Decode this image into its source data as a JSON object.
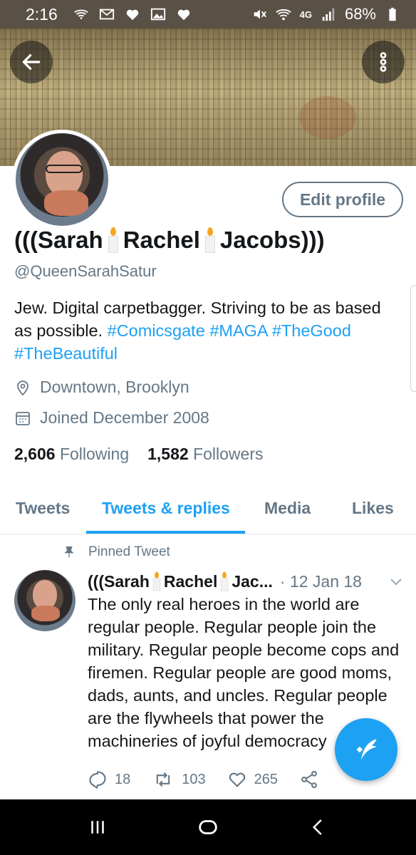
{
  "status_bar": {
    "time": "2:16",
    "battery": "68%",
    "network": "4G"
  },
  "profile": {
    "name_parts": [
      "(((Sarah",
      "Rachel",
      "Jacobs)))"
    ],
    "handle": "@QueenSarahSatur",
    "bio_text": "Jew. Digital carpetbagger. Striving to be as based as possible.",
    "bio_tags": [
      "#Comicsgate",
      "#MAGA",
      "#TheGood",
      "#TheBeautiful"
    ],
    "location": "Downtown, Brooklyn",
    "joined": "Joined December 2008",
    "following_count": "2,606",
    "following_label": "Following",
    "followers_count": "1,582",
    "followers_label": "Followers",
    "edit_label": "Edit profile"
  },
  "tabs": [
    {
      "label": "Tweets"
    },
    {
      "label": "Tweets & replies",
      "active": true
    },
    {
      "label": "Media"
    },
    {
      "label": "Likes"
    }
  ],
  "pinned_label": "Pinned Tweet",
  "tweet": {
    "name_parts": [
      "(((Sarah",
      "Rachel",
      "Jac..."
    ],
    "date": "· 12 Jan 18",
    "text": "The only real heroes in the world are regular people. Regular people join the military. Regular people become cops and firemen. Regular people are good moms, dads, aunts, and uncles. Regular people are the flywheels that power the machineries of joyful democracy",
    "replies": "18",
    "retweets": "103",
    "likes": "265"
  },
  "colors": {
    "accent": "#1da1f2",
    "muted": "#657786",
    "text": "#14171a"
  }
}
